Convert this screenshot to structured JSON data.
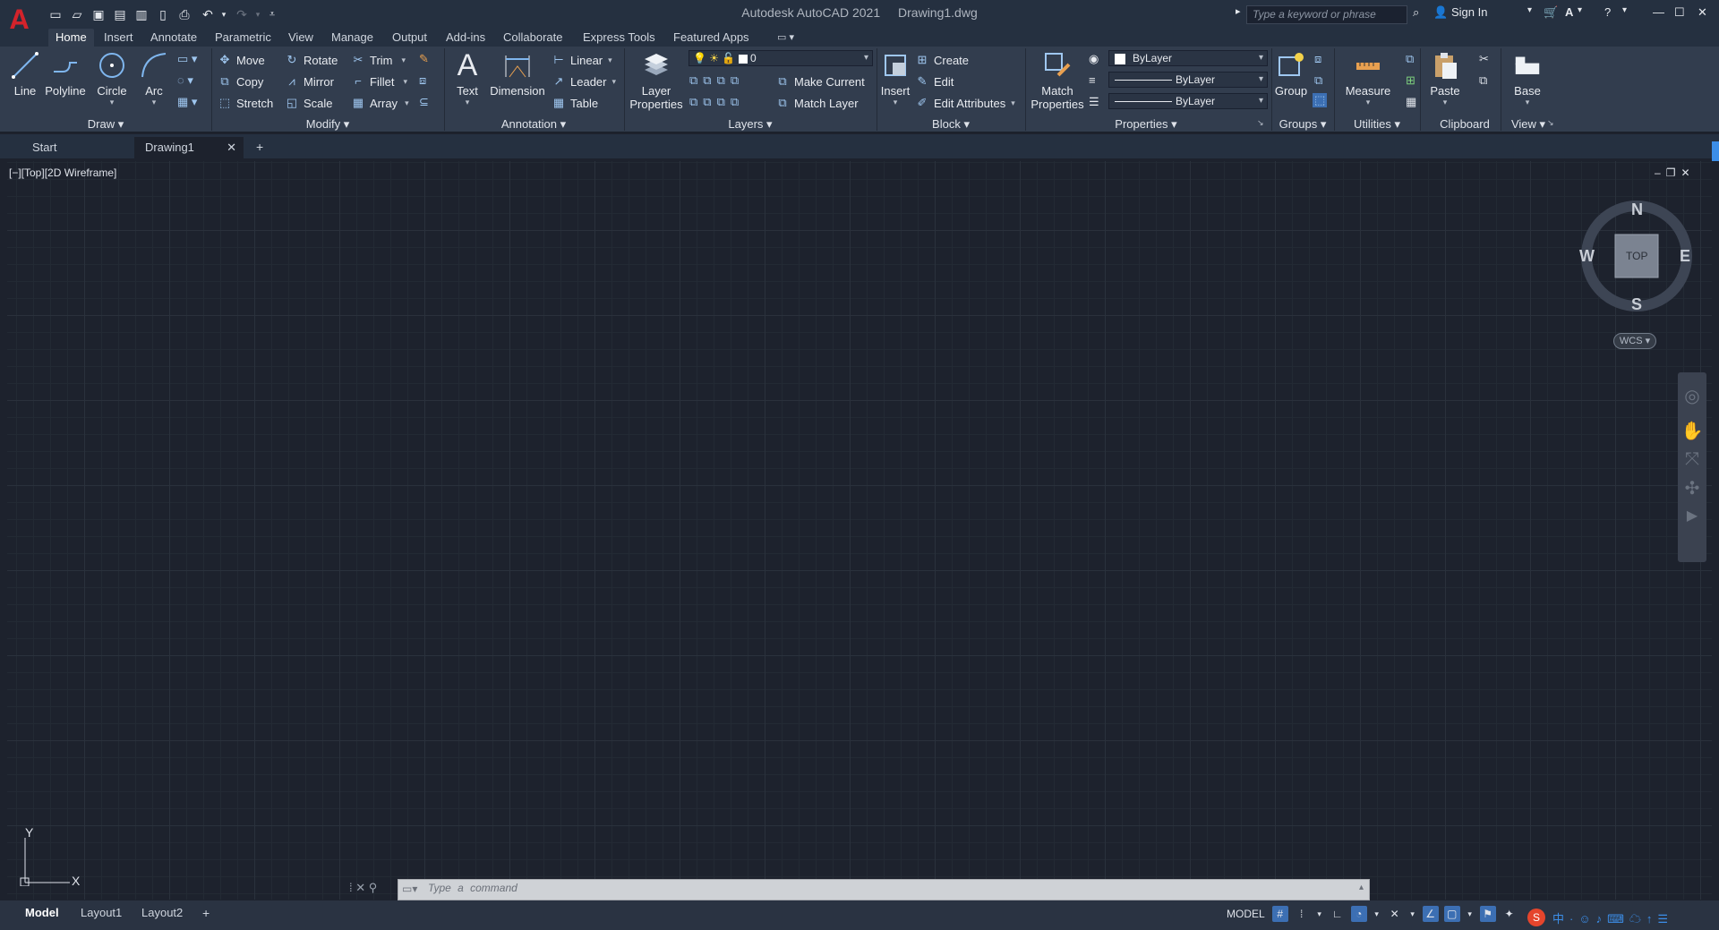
{
  "app": {
    "title": "Autodesk AutoCAD 2021",
    "document": "Drawing1.dwg",
    "logo_letter": "A"
  },
  "search": {
    "placeholder": "Type a keyword or phrase"
  },
  "account": {
    "sign_in": "Sign In"
  },
  "menu_tabs": [
    "Home",
    "Insert",
    "Annotate",
    "Parametric",
    "View",
    "Manage",
    "Output",
    "Add-ins",
    "Collaborate",
    "Express Tools",
    "Featured Apps"
  ],
  "ribbon": {
    "draw": {
      "label": "Draw",
      "line": "Line",
      "polyline": "Polyline",
      "circle": "Circle",
      "arc": "Arc"
    },
    "modify": {
      "label": "Modify",
      "move": "Move",
      "rotate": "Rotate",
      "trim": "Trim",
      "copy": "Copy",
      "mirror": "Mirror",
      "fillet": "Fillet",
      "stretch": "Stretch",
      "scale": "Scale",
      "array": "Array"
    },
    "annotation": {
      "label": "Annotation",
      "text": "Text",
      "dimension": "Dimension",
      "linear": "Linear",
      "leader": "Leader",
      "table": "Table"
    },
    "layers": {
      "label": "Layers",
      "layer_properties_1": "Layer",
      "layer_properties_2": "Properties",
      "current_layer": "0",
      "make_current": "Make Current",
      "match_layer": "Match Layer"
    },
    "block": {
      "label": "Block",
      "insert": "Insert",
      "create": "Create",
      "edit": "Edit",
      "edit_attributes": "Edit Attributes"
    },
    "properties": {
      "label": "Properties",
      "match_1": "Match",
      "match_2": "Properties",
      "color": "ByLayer",
      "linetype": "ByLayer",
      "lineweight": "ByLayer"
    },
    "groups": {
      "label": "Groups",
      "group": "Group"
    },
    "utilities": {
      "label": "Utilities",
      "measure": "Measure"
    },
    "clipboard": {
      "label": "Clipboard",
      "paste": "Paste"
    },
    "view": {
      "label": "View",
      "base": "Base"
    }
  },
  "doc_tabs": [
    "Start",
    "Drawing1"
  ],
  "viewport": {
    "label": "[−][Top][2D Wireframe]"
  },
  "viewcube": {
    "n": "N",
    "s": "S",
    "e": "E",
    "w": "W",
    "face": "TOP",
    "wcs": "WCS"
  },
  "ucs": {
    "x": "X",
    "y": "Y"
  },
  "command": {
    "placeholder": "Type  a  command"
  },
  "layout_tabs": [
    "Model",
    "Layout1",
    "Layout2"
  ],
  "status": {
    "model": "MODEL"
  },
  "colors": {
    "accent": "#3c6fb3",
    "brand_red": "#d3232b",
    "background": "#1d222d",
    "ribbon": "#323d4e"
  }
}
